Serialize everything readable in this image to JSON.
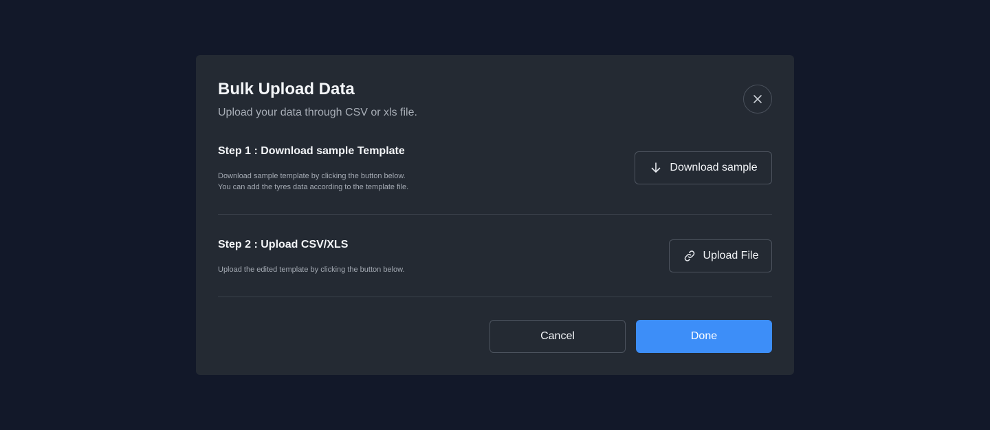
{
  "modal": {
    "title": "Bulk Upload Data",
    "subtitle": "Upload your data through CSV or xls file."
  },
  "step1": {
    "title": "Step 1 : Download sample Template",
    "desc_line1": "Download sample template by clicking the button below.",
    "desc_line2": "You can add the tyres data according to the template file.",
    "button_label": "Download sample",
    "button_icon": "arrow-down-icon"
  },
  "step2": {
    "title": "Step 2 : Upload CSV/XLS",
    "desc": "Upload the edited template by clicking the button below.",
    "button_label": "Upload File",
    "button_icon": "link-icon"
  },
  "footer": {
    "cancel_label": "Cancel",
    "done_label": "Done"
  },
  "colors": {
    "background": "#121829",
    "modal": "#242a33",
    "accent": "#3d8ef8"
  }
}
